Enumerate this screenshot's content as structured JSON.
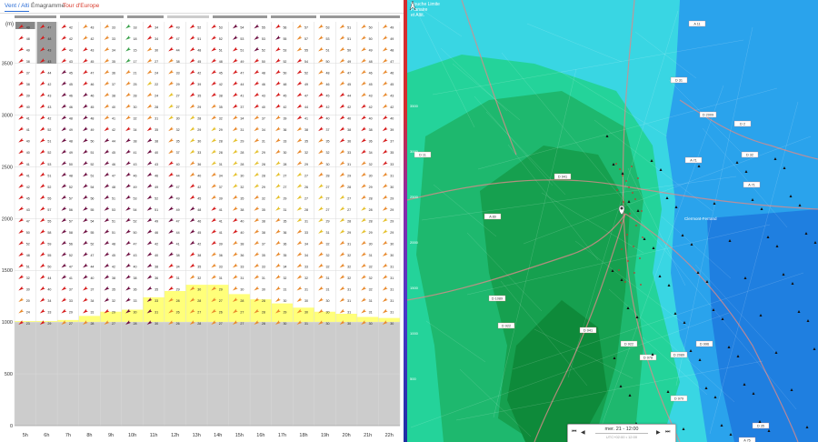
{
  "tabs": [
    {
      "label": "Vent / Alti"
    },
    {
      "label": "Émagramme"
    },
    {
      "label": "Tour d'Europe"
    }
  ],
  "chart_data": {
    "type": "wind-barb-grid",
    "ylabel": "(m)",
    "y_ticks": [
      0,
      500,
      1000,
      1500,
      2000,
      2500,
      3000,
      3500
    ],
    "ylim": [
      0,
      3900
    ],
    "ground_altitude_m": 1000,
    "hours": [
      "5h",
      "6h",
      "7h",
      "8h",
      "9h",
      "10h",
      "11h",
      "12h",
      "13h",
      "14h",
      "15h",
      "16h",
      "17h",
      "18h",
      "19h",
      "20h",
      "21h",
      "22h"
    ],
    "colors": {
      "barb_dark": "#6b0b3e",
      "barb_red": "#d51818",
      "barb_orange": "#e8882a",
      "barb_yellow": "#e5c02a",
      "barb_green": "#3aa14a",
      "thermal_zone": "#ffff7a",
      "ground_zone": "#cccccc",
      "grid": "#d9d9d9"
    },
    "columns": [
      {
        "speeds": [
          49,
          48,
          49,
          38,
          37,
          38,
          39,
          40,
          41,
          41,
          40,
          40,
          41,
          41,
          42,
          45,
          43,
          47,
          50,
          52,
          48,
          51,
          32,
          30,
          20,
          24,
          23
        ],
        "colors": [
          "red",
          "red",
          "red",
          "red",
          "red",
          "red",
          "red",
          "red",
          "red",
          "red",
          "red",
          "red",
          "red",
          "red",
          "red",
          "red",
          "red",
          "red",
          "red",
          "red",
          "red",
          "red",
          "red",
          "red",
          "orange",
          "orange",
          "red"
        ]
      },
      {
        "speeds": [
          47,
          48,
          43,
          43,
          44,
          42,
          43,
          43,
          42,
          52,
          51,
          52,
          53,
          51,
          52,
          55,
          57,
          55,
          58,
          59,
          55,
          50,
          44,
          40,
          34,
          33,
          29
        ],
        "colors": [
          "red",
          "red",
          "red",
          "red",
          "red",
          "red",
          "red",
          "red",
          "red",
          "red",
          "red",
          "red",
          "red",
          "red",
          "red",
          "red",
          "red",
          "red",
          "red",
          "red",
          "red",
          "red",
          "red",
          "red",
          "red",
          "red",
          "red"
        ]
      },
      {
        "speeds": [
          42,
          42,
          43,
          43,
          45,
          45,
          46,
          46,
          48,
          49,
          48,
          49,
          50,
          48,
          52,
          57,
          56,
          57,
          58,
          56,
          52,
          47,
          41,
          37,
          33,
          29,
          27
        ],
        "colors": [
          "red",
          "red",
          "red",
          "red",
          "dark",
          "dark",
          "dark",
          "dark",
          "dark",
          "dark",
          "dark",
          "dark",
          "dark",
          "dark",
          "dark",
          "dark",
          "dark",
          "dark",
          "dark",
          "dark",
          "dark",
          "dark",
          "dark",
          "red",
          "red",
          "red",
          "orange"
        ]
      },
      {
        "speeds": [
          43,
          42,
          43,
          45,
          47,
          46,
          46,
          45,
          48,
          49,
          50,
          51,
          52,
          51,
          54,
          56,
          55,
          54,
          55,
          52,
          47,
          44,
          40,
          37,
          34,
          31,
          28
        ],
        "colors": [
          "orange",
          "orange",
          "red",
          "red",
          "red",
          "red",
          "dark",
          "dark",
          "dark",
          "dark",
          "dark",
          "dark",
          "dark",
          "dark",
          "dark",
          "dark",
          "dark",
          "dark",
          "dark",
          "dark",
          "dark",
          "dark",
          "dark",
          "red",
          "red",
          "red",
          "orange"
        ]
      },
      {
        "speeds": [
          33,
          33,
          34,
          35,
          36,
          37,
          38,
          40,
          41,
          42,
          44,
          45,
          46,
          47,
          48,
          51,
          53,
          51,
          51,
          48,
          45,
          42,
          38,
          35,
          32,
          29,
          27
        ],
        "colors": [
          "orange",
          "orange",
          "orange",
          "orange",
          "orange",
          "orange",
          "orange",
          "orange",
          "orange",
          "red",
          "dark",
          "dark",
          "dark",
          "dark",
          "dark",
          "dark",
          "dark",
          "dark",
          "dark",
          "dark",
          "dark",
          "dark",
          "dark",
          "dark",
          "dark",
          "red",
          "orange"
        ]
      },
      {
        "speeds": [
          18,
          18,
          15,
          17,
          21,
          25,
          28,
          30,
          32,
          34,
          38,
          41,
          43,
          46,
          49,
          53,
          54,
          52,
          50,
          47,
          43,
          40,
          38,
          36,
          33,
          30,
          28
        ],
        "colors": [
          "green",
          "green",
          "green",
          "green",
          "orange",
          "orange",
          "orange",
          "orange",
          "orange",
          "red",
          "dark",
          "dark",
          "dark",
          "dark",
          "dark",
          "dark",
          "dark",
          "dark",
          "dark",
          "dark",
          "dark",
          "dark",
          "dark",
          "dark",
          "dark",
          "dark",
          "dark"
        ]
      },
      {
        "speeds": [
          34,
          34,
          30,
          27,
          24,
          22,
          24,
          28,
          31,
          35,
          38,
          40,
          43,
          46,
          49,
          52,
          51,
          49,
          46,
          42,
          40,
          38,
          36,
          35,
          33,
          31,
          30
        ],
        "colors": [
          "red",
          "red",
          "orange",
          "orange",
          "orange",
          "yellow",
          "orange",
          "orange",
          "orange",
          "red",
          "dark",
          "dark",
          "dark",
          "dark",
          "dark",
          "dark",
          "dark",
          "dark",
          "dark",
          "dark",
          "dark",
          "dark",
          "dark",
          "dark",
          "dark",
          "dark",
          "dark"
        ]
      },
      {
        "speeds": [
          49,
          47,
          44,
          38,
          33,
          29,
          27,
          27,
          30,
          32,
          35,
          37,
          40,
          44,
          47,
          49,
          49,
          47,
          44,
          41,
          38,
          34,
          31,
          29,
          28,
          26,
          26
        ],
        "colors": [
          "red",
          "red",
          "red",
          "orange",
          "orange",
          "orange",
          "yellow",
          "yellow",
          "yellow",
          "orange",
          "orange",
          "orange",
          "red",
          "red",
          "dark",
          "dark",
          "dark",
          "dark",
          "dark",
          "dark",
          "dark",
          "red",
          "red",
          "red",
          "orange",
          "orange",
          "orange"
        ]
      },
      {
        "speeds": [
          52,
          51,
          48,
          45,
          42,
          39,
          35,
          29,
          28,
          29,
          30,
          33,
          36,
          40,
          42,
          45,
          48,
          46,
          45,
          42,
          38,
          35,
          32,
          30,
          28,
          27,
          28
        ],
        "colors": [
          "red",
          "red",
          "red",
          "red",
          "red",
          "red",
          "red",
          "orange",
          "yellow",
          "yellow",
          "yellow",
          "yellow",
          "orange",
          "orange",
          "red",
          "red",
          "dark",
          "dark",
          "dark",
          "dark",
          "red",
          "red",
          "orange",
          "orange",
          "orange",
          "orange",
          "orange"
        ]
      },
      {
        "speeds": [
          53,
          52,
          51,
          48,
          45,
          42,
          38,
          35,
          32,
          29,
          28,
          28,
          31,
          34,
          37,
          39,
          41,
          41,
          41,
          39,
          36,
          33,
          31,
          29,
          27,
          26,
          27
        ],
        "colors": [
          "red",
          "red",
          "red",
          "red",
          "red",
          "red",
          "red",
          "orange",
          "orange",
          "yellow",
          "yellow",
          "yellow",
          "yellow",
          "orange",
          "orange",
          "orange",
          "red",
          "red",
          "red",
          "red",
          "orange",
          "orange",
          "orange",
          "orange",
          "orange",
          "orange",
          "orange"
        ]
      },
      {
        "speeds": [
          54,
          53,
          51,
          49,
          47,
          44,
          41,
          37,
          34,
          31,
          29,
          28,
          28,
          30,
          32,
          35,
          38,
          40,
          40,
          38,
          36,
          33,
          31,
          30,
          28,
          27,
          27
        ],
        "colors": [
          "dark",
          "dark",
          "red",
          "red",
          "red",
          "red",
          "red",
          "red",
          "orange",
          "orange",
          "yellow",
          "yellow",
          "yellow",
          "yellow",
          "yellow",
          "orange",
          "orange",
          "red",
          "red",
          "orange",
          "orange",
          "orange",
          "orange",
          "orange",
          "orange",
          "orange",
          "orange"
        ]
      },
      {
        "speeds": [
          55,
          53,
          52,
          50,
          48,
          46,
          43,
          40,
          37,
          34,
          31,
          29,
          28,
          28,
          29,
          32,
          35,
          38,
          38,
          37,
          35,
          33,
          31,
          30,
          28,
          28,
          28
        ],
        "colors": [
          "dark",
          "dark",
          "dark",
          "red",
          "red",
          "red",
          "red",
          "red",
          "orange",
          "orange",
          "orange",
          "yellow",
          "yellow",
          "yellow",
          "yellow",
          "orange",
          "orange",
          "orange",
          "orange",
          "orange",
          "orange",
          "orange",
          "orange",
          "orange",
          "orange",
          "orange",
          "orange"
        ]
      },
      {
        "speeds": [
          56,
          55,
          53,
          52,
          50,
          48,
          45,
          42,
          39,
          36,
          33,
          30,
          28,
          27,
          27,
          29,
          31,
          35,
          36,
          36,
          35,
          34,
          32,
          31,
          30,
          29,
          30
        ],
        "colors": [
          "red",
          "dark",
          "red",
          "red",
          "red",
          "red",
          "red",
          "red",
          "orange",
          "orange",
          "orange",
          "orange",
          "yellow",
          "yellow",
          "yellow",
          "yellow",
          "yellow",
          "orange",
          "orange",
          "orange",
          "orange",
          "orange",
          "orange",
          "orange",
          "orange",
          "orange",
          "orange"
        ]
      },
      {
        "speeds": [
          57,
          57,
          55,
          54,
          52,
          49,
          47,
          44,
          41,
          38,
          35,
          32,
          29,
          27,
          26,
          27,
          28,
          31,
          33,
          34,
          34,
          33,
          32,
          31,
          30,
          30,
          31
        ],
        "colors": [
          "orange",
          "orange",
          "orange",
          "red",
          "red",
          "red",
          "red",
          "red",
          "red",
          "orange",
          "orange",
          "orange",
          "orange",
          "yellow",
          "yellow",
          "yellow",
          "yellow",
          "yellow",
          "orange",
          "orange",
          "orange",
          "orange",
          "orange",
          "orange",
          "orange",
          "orange",
          "orange"
        ]
      },
      {
        "speeds": [
          53,
          53,
          51,
          50,
          48,
          46,
          45,
          42,
          40,
          37,
          35,
          32,
          30,
          28,
          27,
          27,
          27,
          29,
          31,
          32,
          32,
          32,
          31,
          31,
          30,
          30,
          30
        ],
        "colors": [
          "orange",
          "orange",
          "orange",
          "orange",
          "orange",
          "orange",
          "red",
          "red",
          "red",
          "red",
          "orange",
          "orange",
          "orange",
          "orange",
          "yellow",
          "yellow",
          "yellow",
          "yellow",
          "yellow",
          "orange",
          "orange",
          "orange",
          "orange",
          "orange",
          "orange",
          "orange",
          "orange"
        ]
      },
      {
        "speeds": [
          51,
          51,
          50,
          49,
          47,
          45,
          44,
          42,
          40,
          38,
          36,
          33,
          31,
          29,
          28,
          27,
          27,
          28,
          29,
          31,
          32,
          32,
          32,
          31,
          31,
          31,
          30
        ],
        "colors": [
          "orange",
          "orange",
          "orange",
          "orange",
          "orange",
          "orange",
          "red",
          "red",
          "red",
          "red",
          "red",
          "orange",
          "orange",
          "orange",
          "orange",
          "yellow",
          "yellow",
          "yellow",
          "yellow",
          "orange",
          "orange",
          "orange",
          "orange",
          "orange",
          "orange",
          "orange",
          "orange"
        ]
      },
      {
        "speeds": [
          50,
          50,
          49,
          48,
          46,
          45,
          43,
          42,
          40,
          38,
          36,
          34,
          32,
          30,
          29,
          28,
          28,
          28,
          29,
          30,
          31,
          32,
          32,
          32,
          31,
          31,
          30
        ],
        "colors": [
          "orange",
          "orange",
          "orange",
          "orange",
          "orange",
          "orange",
          "orange",
          "red",
          "red",
          "red",
          "red",
          "red",
          "orange",
          "orange",
          "orange",
          "orange",
          "yellow",
          "yellow",
          "yellow",
          "orange",
          "orange",
          "orange",
          "orange",
          "orange",
          "orange",
          "orange",
          "orange"
        ]
      },
      {
        "speeds": [
          49,
          49,
          48,
          47,
          46,
          45,
          43,
          42,
          40,
          39,
          37,
          35,
          33,
          31,
          30,
          29,
          29,
          29,
          29,
          30,
          30,
          31,
          31,
          31,
          31,
          31,
          30
        ],
        "colors": [
          "orange",
          "orange",
          "orange",
          "orange",
          "orange",
          "orange",
          "orange",
          "orange",
          "red",
          "red",
          "red",
          "red",
          "red",
          "orange",
          "orange",
          "orange",
          "orange",
          "yellow",
          "yellow",
          "orange",
          "orange",
          "orange",
          "orange",
          "orange",
          "orange",
          "orange",
          "orange"
        ]
      }
    ],
    "thermal_top_m": [
      1010,
      1010,
      1020,
      1060,
      1100,
      1120,
      1240,
      1300,
      1360,
      1360,
      1270,
      1220,
      1180,
      1140,
      1100,
      1080,
      1050,
      1040
    ]
  },
  "map": {
    "title_line1": "Couche Limite",
    "title_line2": "Planaire",
    "title_line3": "et Altit.",
    "left_scale": [
      "3500",
      "3000",
      "2500",
      "2000",
      "1500",
      "1000",
      "500"
    ],
    "road_labels": [
      "A 11",
      "D 31",
      "D 2009",
      "D 2",
      "A 71",
      "D 32",
      "A 71",
      "D 11",
      "A 89",
      "D 941",
      "D 1089",
      "D 941",
      "D 922",
      "D 922",
      "D 2089",
      "D 996",
      "D 978",
      "D 979",
      "D 35",
      "A 75"
    ],
    "town": "Clermont-Ferrand",
    "player": {
      "time_label": "mer. 21 - 12:00",
      "sub_label": "UTC+02:00 • 12:00",
      "prev_label": "⏮",
      "back_label": "◀",
      "fwd_label": "▶",
      "next_label": "⏭"
    }
  }
}
